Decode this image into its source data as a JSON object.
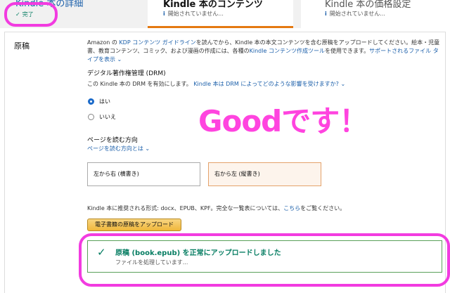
{
  "tabs": [
    {
      "title": "Kindle 本の詳細",
      "status": "完了"
    },
    {
      "title": "Kindle 本のコンテンツ",
      "status": "開始されていません..."
    },
    {
      "title": "Kindle 本の価格設定",
      "status": "開始されていません..."
    }
  ],
  "section": {
    "label": "原稿"
  },
  "intro": {
    "text1": "Amazon の ",
    "link1": "KDP コンテンツ ガイドライン",
    "text2": "を読んでから、Kindle 本の本文コンテンツを含む原稿をアップロードしてください。絵本・児童書、教育コンテンツ、コミック、および漫画の作成には、各種の",
    "link2": "Kindle コンテンツ作成ツール",
    "text3": "を使用できます。",
    "link3": "サポートされるファイル タイプを表示"
  },
  "drm": {
    "title": "デジタル著作権管理 (DRM)",
    "desc": "この Kindle 本の DRM を有効にします。",
    "link": "Kindle 本は DRM によってどのような影響を受けますか?",
    "option_yes": "はい",
    "option_no": "いいえ",
    "selected": "はい"
  },
  "reading_direction": {
    "title": "ページを読む方向",
    "link": "ページを読む方向とは",
    "left_to_right": "左から右 (横書き)",
    "right_to_left": "右から左 (縦書き)",
    "selected": "右から左 (縦書き)"
  },
  "formats": {
    "text": "Kindle 本に推奨される形式: docx、EPUB、KPF。完全な一覧表については、",
    "link": "こちら",
    "suffix": "をご覧ください。"
  },
  "upload": {
    "button": "電子書籍の原稿をアップロード",
    "success": "原稿 (book.epub) を正常にアップロードしました",
    "processing": "ファイルを処理しています..."
  },
  "annotation": {
    "text": "Goodです！",
    "color": "#ff44df"
  },
  "colors": {
    "accent": "#e47911",
    "link": "#1b5faa",
    "success": "#067d62"
  }
}
